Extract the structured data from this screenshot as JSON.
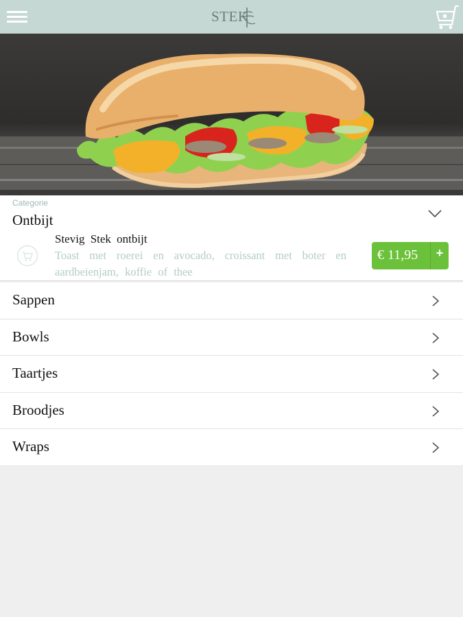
{
  "header": {
    "logo_text": "STEK",
    "menu_icon": "hamburger-menu-icon",
    "cart_icon": "shopping-cart-icon"
  },
  "hero": {
    "image": "sandwich-photo"
  },
  "category_select": {
    "caption": "Categorie",
    "value": "Ontbijt",
    "icon": "chevron-down-icon"
  },
  "product": {
    "name": "Stevig  Stek  ontbijt",
    "description": "Toast met roerei en avocado,  croissant  met boter en aardbeienjam,   koffie of thee",
    "price": "€ 11,95",
    "add_label": "+",
    "icon": "cart-circle-icon"
  },
  "categories": [
    {
      "label": "Sappen"
    },
    {
      "label": "Bowls"
    },
    {
      "label": "Taartjes"
    },
    {
      "label": "Broodjes"
    },
    {
      "label": "Wraps"
    }
  ],
  "colors": {
    "header_bg": "#c6d8d3",
    "accent_green": "#6cc13a",
    "muted_text": "#b3cdc7"
  }
}
